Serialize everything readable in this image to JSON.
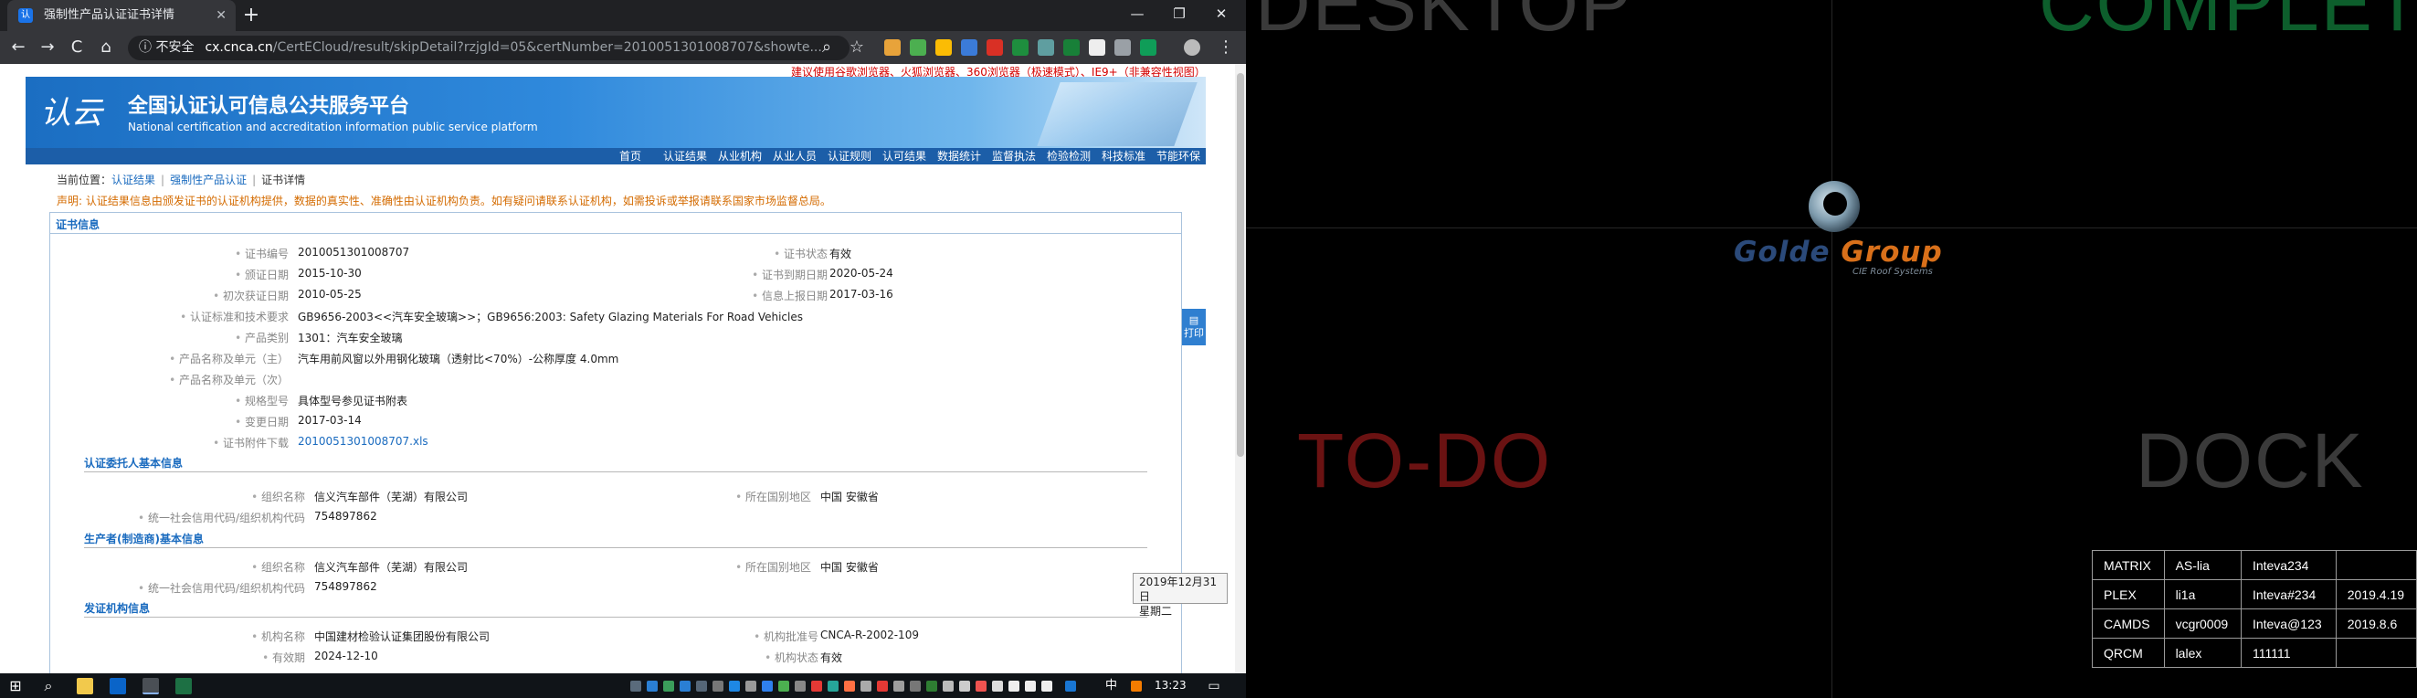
{
  "browser": {
    "tab_title": "强制性产品认证证书详情",
    "tab_favicon_text": "认",
    "new_tab": "+",
    "window_controls": [
      "—",
      "❐",
      "✕"
    ],
    "nav": {
      "back": "←",
      "forward": "→",
      "reload": "C",
      "home": "⌂"
    },
    "omnibox": {
      "security_label": "ⓘ 不安全",
      "domain": "cx.cnca.cn",
      "path": "/CertECloud/result/skipDetail?rzjgId=05&certNumber=2010051301008707&showte..."
    },
    "toolbar_icons": {
      "search": "⌕",
      "bookmark_star": "☆",
      "menu": "⋮"
    }
  },
  "page": {
    "top_notice": "建议使用谷歌浏览器、火狐浏览器、360浏览器（极速模式）、IE9+（非兼容性视图）",
    "banner": {
      "logo_text": "认云",
      "title": "全国认证认可信息公共服务平台",
      "subtitle": "National certification and accreditation information public service platform"
    },
    "main_nav": [
      "首页",
      "认证结果",
      "从业机构",
      "从业人员",
      "认证规则",
      "认可结果",
      "数据统计",
      "监督执法",
      "检验检测",
      "科技标准",
      "节能环保"
    ],
    "breadcrumb": {
      "prefix": "当前位置：",
      "items": [
        "认证结果",
        "强制性产品认证",
        "证书详情"
      ],
      "separator": "|"
    },
    "disclaimer": "声明: 认证结果信息由颁发证书的认证机构提供，数据的真实性、准确性由认证机构负责。如有疑问请联系认证机构，如需投诉或举报请联系国家市场监督总局。",
    "print_label": "打印",
    "cert_section_title": "证书信息",
    "cert": {
      "cert_no_label": "证书编号",
      "cert_no": "2010051301008707",
      "status_label": "证书状态",
      "status": "有效",
      "issue_date_label": "颁证日期",
      "issue_date": "2015-10-30",
      "expiry_label": "证书到期日期",
      "expiry": "2020-05-24",
      "first_date_label": "初次获证日期",
      "first_date": "2010-05-25",
      "upload_label": "信息上报日期",
      "upload": "2017-03-16",
      "standard_label": "认证标准和技术要求",
      "standard": "GB9656-2003<<汽车安全玻璃>>；GB9656:2003: Safety Glazing Materials For Road Vehicles",
      "category_label": "产品类别",
      "category": "1301：汽车安全玻璃",
      "product_main_label": "产品名称及单元（主）",
      "product_main": "汽车用前风窗以外用钢化玻璃（透射比<70%）-公称厚度 4.0mm",
      "product_sub_label": "产品名称及单元（次）",
      "product_sub": "",
      "model_label": "规格型号",
      "model": "具体型号参见证书附表",
      "change_label": "变更日期",
      "change_date": "2017-03-14",
      "attach_label": "证书附件下载",
      "attach": "2010051301008707.xls"
    },
    "client": {
      "title": "认证委托人基本信息",
      "org_label": "组织名称",
      "org": "信义汽车部件（芜湖）有限公司",
      "region_label": "所在国别地区",
      "region": "中国 安徽省",
      "code_label": "统一社会信用代码/组织机构代码",
      "code": "754897862"
    },
    "producer": {
      "title": "生产者(制造商)基本信息",
      "org_label": "组织名称",
      "org": "信义汽车部件（芜湖）有限公司",
      "region_label": "所在国别地区",
      "region": "中国 安徽省",
      "code_label": "统一社会信用代码/组织机构代码",
      "code": "754897862"
    },
    "issuer": {
      "title": "发证机构信息",
      "name_label": "机构名称",
      "name": "中国建材检验认证集团股份有限公司",
      "approval_label": "机构批准号",
      "approval": "CNCA-R-2002-109",
      "valid_label": "有效期",
      "valid": "2024-12-10",
      "state_label": "机构状态",
      "state": "有效"
    },
    "date_tooltip": {
      "date": "2019年12月31日",
      "weekday": "星期二"
    }
  },
  "taskbar": {
    "start": "⊞",
    "search": "⌕",
    "lang": "中",
    "time": "13:23",
    "notification": "▭"
  },
  "desktop": {
    "labels": {
      "desktop": "DESKTOP",
      "complete": "COMPLETE",
      "todo": "TO-DO",
      "dock": "DOCK"
    },
    "label_colors": {
      "desktop": "#3a3a3a",
      "complete": "#0d5e2c",
      "todo": "#6a1212",
      "dock": "#3a3a3a"
    },
    "logo": {
      "name_part1": "Golde",
      "name_part2": " Group",
      "tagline": "CIE Roof Systems",
      "color1": "#2b4a7a",
      "color2": "#d9701a"
    },
    "accounts": [
      [
        "MATRIX",
        "AS-lia",
        "Inteva234",
        ""
      ],
      [
        "PLEX",
        "li1a",
        "Inteva#234",
        "2019.4.19"
      ],
      [
        "CAMDS",
        "vcgr0009",
        "Inteva@123",
        "2019.8.6"
      ],
      [
        "QRCM",
        "lalex",
        "111111",
        ""
      ]
    ]
  }
}
